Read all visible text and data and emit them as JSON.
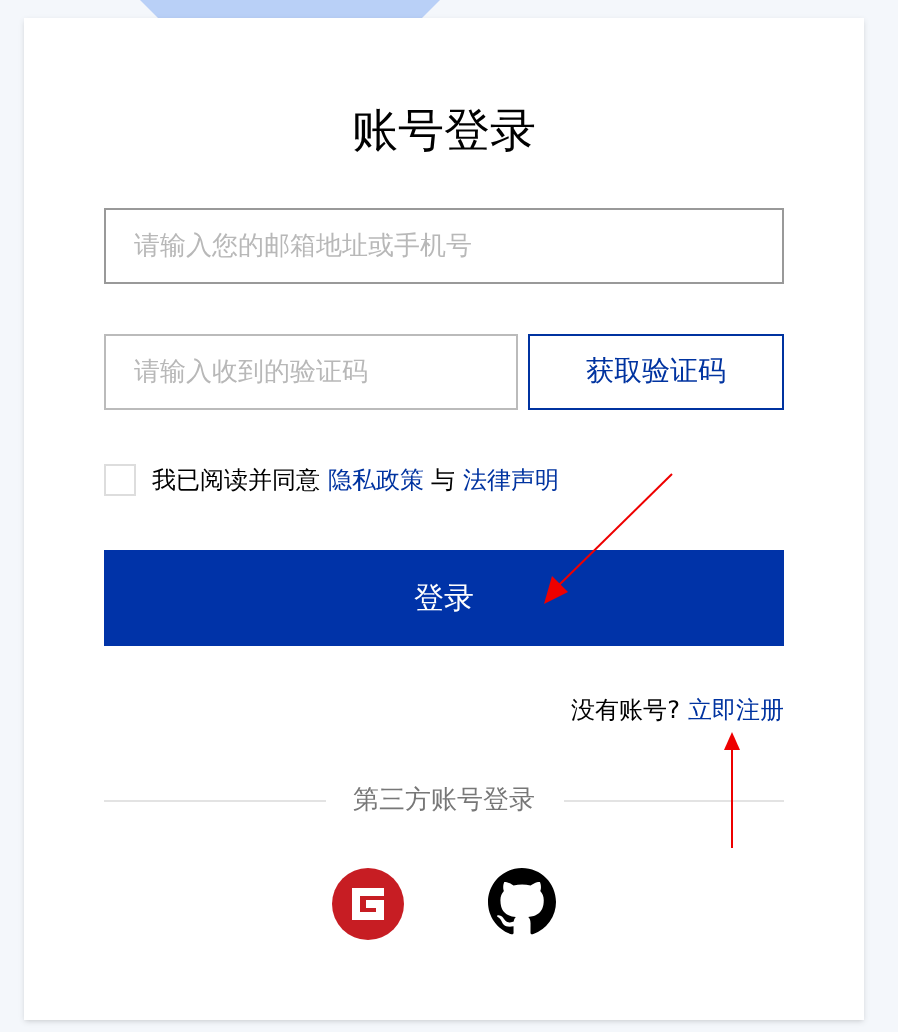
{
  "title": "账号登录",
  "email_field": {
    "placeholder": "请输入您的邮箱地址或手机号"
  },
  "code_field": {
    "placeholder": "请输入收到的验证码"
  },
  "code_button": "获取验证码",
  "agreement": {
    "checked": false,
    "text_before": "我已阅读并同意",
    "link_1": "隐私政策",
    "text_between": "与",
    "link_2": "法律声明"
  },
  "login_button": "登录",
  "register": {
    "prompt": "没有账号?",
    "link": "立即注册"
  },
  "third_party": {
    "label": "第三方账号登录",
    "providers": [
      {
        "kind": "gitee"
      },
      {
        "kind": "github"
      }
    ]
  },
  "annotations": [
    {
      "kind": "arrow-down-left"
    },
    {
      "kind": "arrow-up"
    }
  ]
}
